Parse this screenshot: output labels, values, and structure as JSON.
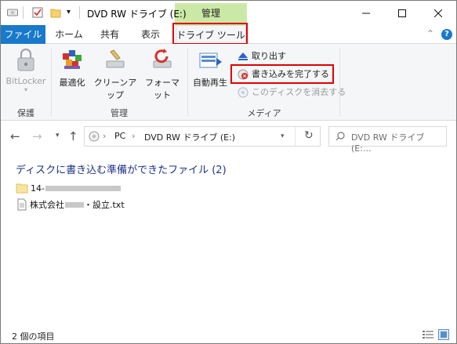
{
  "window": {
    "title": "DVD RW ドライブ (E:)",
    "context_tab_title": "管理"
  },
  "ribbon_tabs": {
    "file": "ファイル",
    "home": "ホーム",
    "share": "共有",
    "view": "表示",
    "drive_tools": "ドライブ ツール"
  },
  "ribbon": {
    "protect_group": {
      "label": "保護",
      "bitlocker": "BitLocker"
    },
    "manage_group": {
      "label": "管理",
      "optimize": "最適化",
      "cleanup": "クリーンアップ",
      "format": "フォーマット"
    },
    "media_group": {
      "label": "メディア",
      "autoplay": "自動再生",
      "eject": "取り出す",
      "finish_burning": "書き込みを完了する",
      "erase_disc": "このディスクを消去する"
    }
  },
  "address_bar": {
    "segments": [
      "PC",
      "DVD RW ドライブ (E:)"
    ],
    "search_placeholder": "DVD RW ドライブ (E:..."
  },
  "content": {
    "group_header": "ディスクに書き込む準備ができたファイル (2)",
    "files": [
      {
        "name_prefix": "14-",
        "type": "folder"
      },
      {
        "name_prefix": "株式会社",
        "name_suffix": "・設立.txt",
        "type": "text"
      }
    ]
  },
  "status_bar": {
    "item_count": "2 個の項目"
  },
  "colors": {
    "file_tab": "#1979ca",
    "context_tab": "#cbe9a6",
    "highlight": "#e00000",
    "group_header": "#1e3287"
  }
}
